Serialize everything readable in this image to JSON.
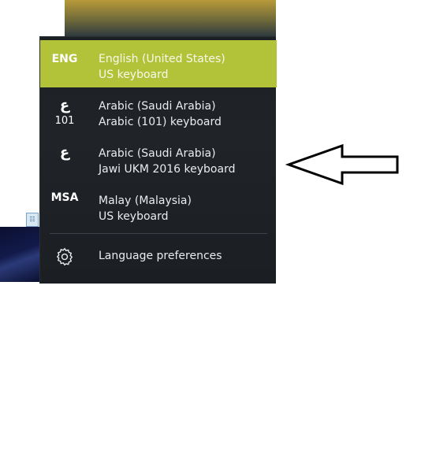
{
  "languages": [
    {
      "code": "ENG",
      "subcode": "",
      "language": "English (United States)",
      "keyboard": "US keyboard",
      "selected": true
    },
    {
      "code": "ع",
      "subcode": "101",
      "language": "Arabic (Saudi Arabia)",
      "keyboard": "Arabic (101) keyboard",
      "selected": false
    },
    {
      "code": "ع",
      "subcode": "",
      "language": "Arabic (Saudi Arabia)",
      "keyboard": "Jawi UKM 2016 keyboard",
      "selected": false
    },
    {
      "code": "MSA",
      "subcode": "",
      "language": "Malay (Malaysia)",
      "keyboard": "US keyboard",
      "selected": false
    }
  ],
  "preferences": {
    "label": "Language preferences",
    "icon": "gear-icon"
  },
  "colors": {
    "accent": "#b2c33a",
    "flyout_bg": "#1f2226",
    "text": "#e9ecef"
  },
  "annotation": {
    "icon": "left-arrow-icon"
  }
}
